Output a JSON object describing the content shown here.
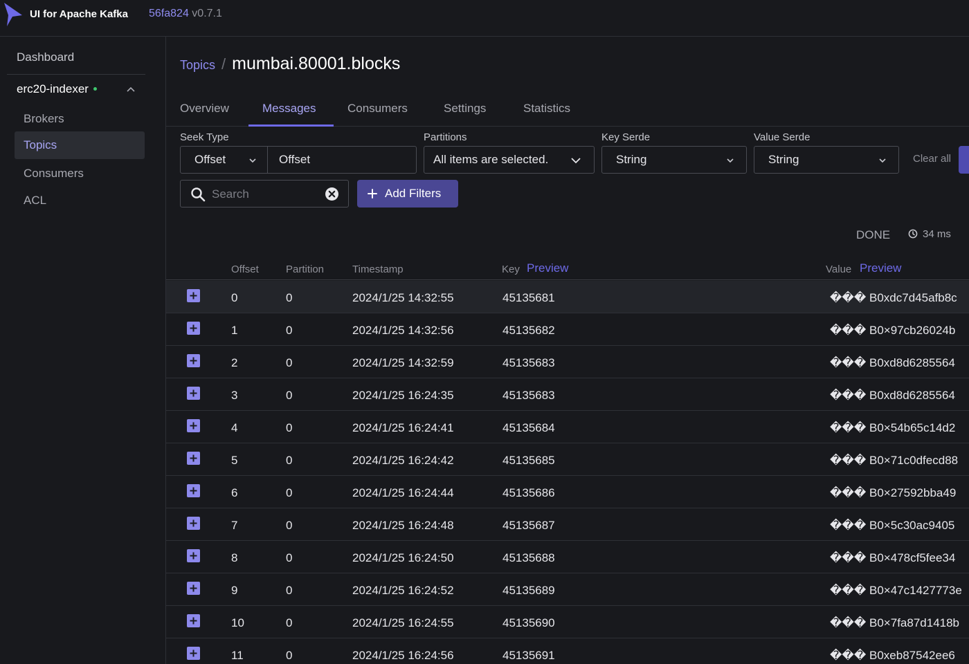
{
  "header": {
    "app_title": "UI for Apache Kafka",
    "commit": "56fa824",
    "version": "v0.7.1"
  },
  "sidebar": {
    "dashboard": "Dashboard",
    "cluster_name": "erc20-indexer",
    "cluster_status_color": "#3fc76e",
    "items": [
      {
        "label": "Brokers",
        "active": false
      },
      {
        "label": "Topics",
        "active": true
      },
      {
        "label": "Consumers",
        "active": false
      },
      {
        "label": "ACL",
        "active": false
      }
    ]
  },
  "breadcrumb": {
    "parent": "Topics",
    "separator": "/",
    "current": "mumbai.80001.blocks"
  },
  "tabs": [
    {
      "label": "Overview"
    },
    {
      "label": "Messages",
      "active": true
    },
    {
      "label": "Consumers"
    },
    {
      "label": "Settings"
    },
    {
      "label": "Statistics"
    }
  ],
  "filters": {
    "seek_type_label": "Seek Type",
    "seek_type_value": "Offset",
    "offset_value": "Offset",
    "partitions_label": "Partitions",
    "partitions_value": "All items are selected.",
    "key_serde_label": "Key Serde",
    "key_serde_value": "String",
    "value_serde_label": "Value Serde",
    "value_serde_value": "String",
    "clear_all": "Clear all",
    "search_placeholder": "Search",
    "add_filters": "Add Filters"
  },
  "status": {
    "state": "DONE",
    "elapsed": "34 ms"
  },
  "table": {
    "columns": {
      "offset": "Offset",
      "partition": "Partition",
      "timestamp": "Timestamp",
      "key": "Key",
      "key_preview": "Preview",
      "value": "Value",
      "value_preview": "Preview"
    },
    "rows": [
      {
        "offset": "0",
        "partition": "0",
        "timestamp": "2024/1/25 14:32:55",
        "key": "45135681",
        "value": "��� B0xdc7d45afb8c"
      },
      {
        "offset": "1",
        "partition": "0",
        "timestamp": "2024/1/25 14:32:56",
        "key": "45135682",
        "value": "��� B0×97cb26024b"
      },
      {
        "offset": "2",
        "partition": "0",
        "timestamp": "2024/1/25 14:32:59",
        "key": "45135683",
        "value": "��� B0xd8d6285564"
      },
      {
        "offset": "3",
        "partition": "0",
        "timestamp": "2024/1/25 16:24:35",
        "key": "45135683",
        "value": "��� B0xd8d6285564"
      },
      {
        "offset": "4",
        "partition": "0",
        "timestamp": "2024/1/25 16:24:41",
        "key": "45135684",
        "value": "��� B0×54b65c14d2"
      },
      {
        "offset": "5",
        "partition": "0",
        "timestamp": "2024/1/25 16:24:42",
        "key": "45135685",
        "value": "��� B0×71c0dfecd88"
      },
      {
        "offset": "6",
        "partition": "0",
        "timestamp": "2024/1/25 16:24:44",
        "key": "45135686",
        "value": "��� B0×27592bba49"
      },
      {
        "offset": "7",
        "partition": "0",
        "timestamp": "2024/1/25 16:24:48",
        "key": "45135687",
        "value": "��� B0×5c30ac9405"
      },
      {
        "offset": "8",
        "partition": "0",
        "timestamp": "2024/1/25 16:24:50",
        "key": "45135688",
        "value": "��� B0×478cf5fee34"
      },
      {
        "offset": "9",
        "partition": "0",
        "timestamp": "2024/1/25 16:24:52",
        "key": "45135689",
        "value": "��� B0×47c1427773e"
      },
      {
        "offset": "10",
        "partition": "0",
        "timestamp": "2024/1/25 16:24:55",
        "key": "45135690",
        "value": "��� B0×7fa87d1418b"
      },
      {
        "offset": "11",
        "partition": "0",
        "timestamp": "2024/1/25 16:24:56",
        "key": "45135691",
        "value": "��� B0xeb87542ee6"
      }
    ]
  }
}
